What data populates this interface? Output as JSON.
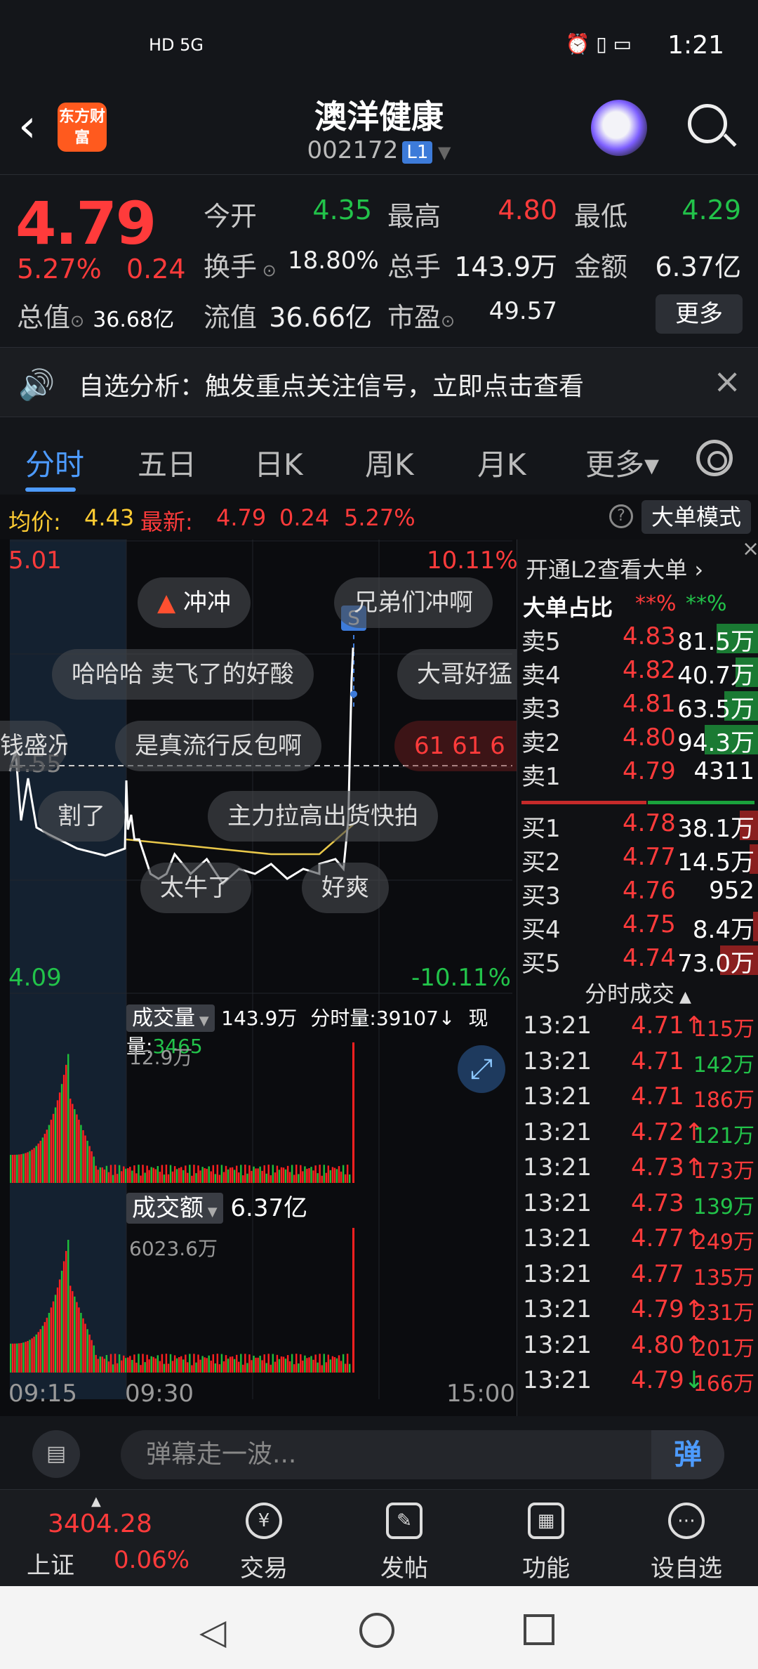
{
  "status_bar": {
    "left_icons": "HD 5G",
    "time": "1:21"
  },
  "header": {
    "title": "澳洋健康",
    "code": "002172",
    "level_badge": "L1",
    "logo_text": "东方财富"
  },
  "quote": {
    "price": "4.79",
    "change_pct": "5.27%",
    "change_amt": "0.24",
    "fields": [
      {
        "label": "今开",
        "value": "4.35",
        "color": "green"
      },
      {
        "label": "最高",
        "value": "4.80",
        "color": "red"
      },
      {
        "label": "最低",
        "value": "4.29",
        "color": "green"
      },
      {
        "label": "换手",
        "value": "18.80%",
        "color": "white"
      },
      {
        "label": "总手",
        "value": "143.9万",
        "color": "white"
      },
      {
        "label": "金额",
        "value": "6.37亿",
        "color": "white"
      },
      {
        "label": "流值",
        "value": "36.66亿",
        "color": "white"
      },
      {
        "label": "市盈",
        "value": "49.57",
        "color": "white"
      }
    ],
    "total_value_label": "总值",
    "total_value": "36.68亿",
    "more_button": "更多"
  },
  "alert": {
    "text": "自选分析：触发重点关注信号，立即点击查看"
  },
  "tabs": [
    {
      "label": "分时",
      "active": true
    },
    {
      "label": "五日",
      "active": false
    },
    {
      "label": "日K",
      "active": false
    },
    {
      "label": "周K",
      "active": false
    },
    {
      "label": "月K",
      "active": false
    },
    {
      "label": "更多▾",
      "active": false
    }
  ],
  "avg_row": {
    "avg_label": "均价:",
    "avg_value": "4.43",
    "latest_label": "最新:",
    "latest_price": "4.79",
    "latest_change": "0.24",
    "latest_pct": "5.27%",
    "mode_button": "大单模式"
  },
  "chart": {
    "price_high": "5.01",
    "pct_high": "10.11%",
    "price_low": "4.09",
    "pct_low": "-10.11%",
    "ref_label": "4.55",
    "signal": "S",
    "volume_label": "成交量",
    "volume_total": "143.9万",
    "volume_fen_label": "分时量:",
    "volume_fen_value": "39107↓",
    "volume_now_label": "现量:",
    "volume_now_value": "3465",
    "volume_max": "12.9万",
    "amount_label": "成交额",
    "amount_total": "6.37亿",
    "amount_max": "6023.6万",
    "time_start": "09:15",
    "time_mid": "09:30",
    "time_end": "15:00"
  },
  "chart_data": {
    "type": "line",
    "series": [
      {
        "name": "price",
        "x": [
          "09:30",
          "09:31",
          "09:33",
          "09:35",
          "09:38",
          "09:42",
          "09:45",
          "09:50",
          "09:55",
          "10:00",
          "10:10",
          "10:20",
          "10:30",
          "10:40",
          "10:50",
          "11:00",
          "11:10",
          "11:20",
          "11:30",
          "13:00",
          "13:10",
          "13:15",
          "13:18",
          "13:20",
          "13:21"
        ],
        "values": [
          4.52,
          4.42,
          4.45,
          4.4,
          4.4,
          4.36,
          4.33,
          4.32,
          4.33,
          4.37,
          4.33,
          4.36,
          4.31,
          4.34,
          4.33,
          4.35,
          4.32,
          4.34,
          4.33,
          4.35,
          4.36,
          4.34,
          4.44,
          4.72,
          4.79
        ]
      },
      {
        "name": "avg",
        "x": [
          "09:30",
          "10:00",
          "10:30",
          "11:00",
          "11:30",
          "13:00",
          "13:21"
        ],
        "values": [
          4.4,
          4.39,
          4.38,
          4.37,
          4.37,
          4.37,
          4.43
        ]
      }
    ],
    "ylim": [
      4.09,
      5.01
    ]
  },
  "danmaku": [
    {
      "text": "冲冲",
      "style": "rocket"
    },
    {
      "text": "兄弟们冲啊"
    },
    {
      "text": "哈哈哈 卖飞了的好酸"
    },
    {
      "text": "大哥好猛"
    },
    {
      "text": "钱盛况"
    },
    {
      "text": "是真流行反包啊"
    },
    {
      "text": "61  61  6",
      "style": "red"
    },
    {
      "text": "割了"
    },
    {
      "text": "主力拉高出货快拍"
    },
    {
      "text": "太牛了"
    },
    {
      "text": "好爽"
    }
  ],
  "right_panel": {
    "l2_text": "开通L2查看大单 ›",
    "big_order_label": "大单占比",
    "big_order_red": "**%",
    "big_order_green": "**%",
    "sells": [
      {
        "label": "卖5",
        "price": "4.83",
        "vol": "81.5万",
        "bar": 0.55
      },
      {
        "label": "卖4",
        "price": "4.82",
        "vol": "40.7万",
        "bar": 0.3
      },
      {
        "label": "卖3",
        "price": "4.81",
        "vol": "63.5万",
        "bar": 0.45
      },
      {
        "label": "卖2",
        "price": "4.80",
        "vol": "94.3万",
        "bar": 0.7
      },
      {
        "label": "卖1",
        "price": "4.79",
        "vol": "4311",
        "bar": 0
      }
    ],
    "buys": [
      {
        "label": "买1",
        "price": "4.78",
        "vol": "38.1万",
        "bar": 0.25
      },
      {
        "label": "买2",
        "price": "4.77",
        "vol": "14.5万",
        "bar": 0.12
      },
      {
        "label": "买3",
        "price": "4.76",
        "vol": "952",
        "bar": 0
      },
      {
        "label": "买4",
        "price": "4.75",
        "vol": "8.4万",
        "bar": 0.07
      },
      {
        "label": "买5",
        "price": "4.74",
        "vol": "73.0万",
        "bar": 0.5
      }
    ],
    "trades_header": "分时成交",
    "trades": [
      {
        "time": "13:21",
        "price": "4.71",
        "arrow": "↑",
        "vol": "115万",
        "color": "red"
      },
      {
        "time": "13:21",
        "price": "4.71",
        "arrow": "",
        "vol": "142万",
        "color": "green"
      },
      {
        "time": "13:21",
        "price": "4.71",
        "arrow": "",
        "vol": "186万",
        "color": "red"
      },
      {
        "time": "13:21",
        "price": "4.72",
        "arrow": "↑",
        "vol": "121万",
        "color": "green"
      },
      {
        "time": "13:21",
        "price": "4.73",
        "arrow": "↑",
        "vol": "173万",
        "color": "red"
      },
      {
        "time": "13:21",
        "price": "4.73",
        "arrow": "",
        "vol": "139万",
        "color": "green"
      },
      {
        "time": "13:21",
        "price": "4.77",
        "arrow": "↑",
        "vol": "249万",
        "color": "red"
      },
      {
        "time": "13:21",
        "price": "4.77",
        "arrow": "",
        "vol": "135万",
        "color": "red"
      },
      {
        "time": "13:21",
        "price": "4.79",
        "arrow": "↑",
        "vol": "231万",
        "color": "red"
      },
      {
        "time": "13:21",
        "price": "4.80",
        "arrow": "↑",
        "vol": "201万",
        "color": "red"
      },
      {
        "time": "13:21",
        "price": "4.79",
        "arrow": "↓",
        "vol": "166万",
        "color": "red"
      }
    ]
  },
  "danmu_input": {
    "placeholder": "弹幕走一波...",
    "send_label": "弹"
  },
  "bottom_nav": {
    "index_value": "3404.28",
    "index_name": "上证",
    "index_pct": "0.06%",
    "items": [
      {
        "label": "交易",
        "icon": "yen-icon"
      },
      {
        "label": "发帖",
        "icon": "edit-icon"
      },
      {
        "label": "功能",
        "icon": "grid-icon"
      },
      {
        "label": "设自选",
        "icon": "more-icon"
      }
    ]
  }
}
